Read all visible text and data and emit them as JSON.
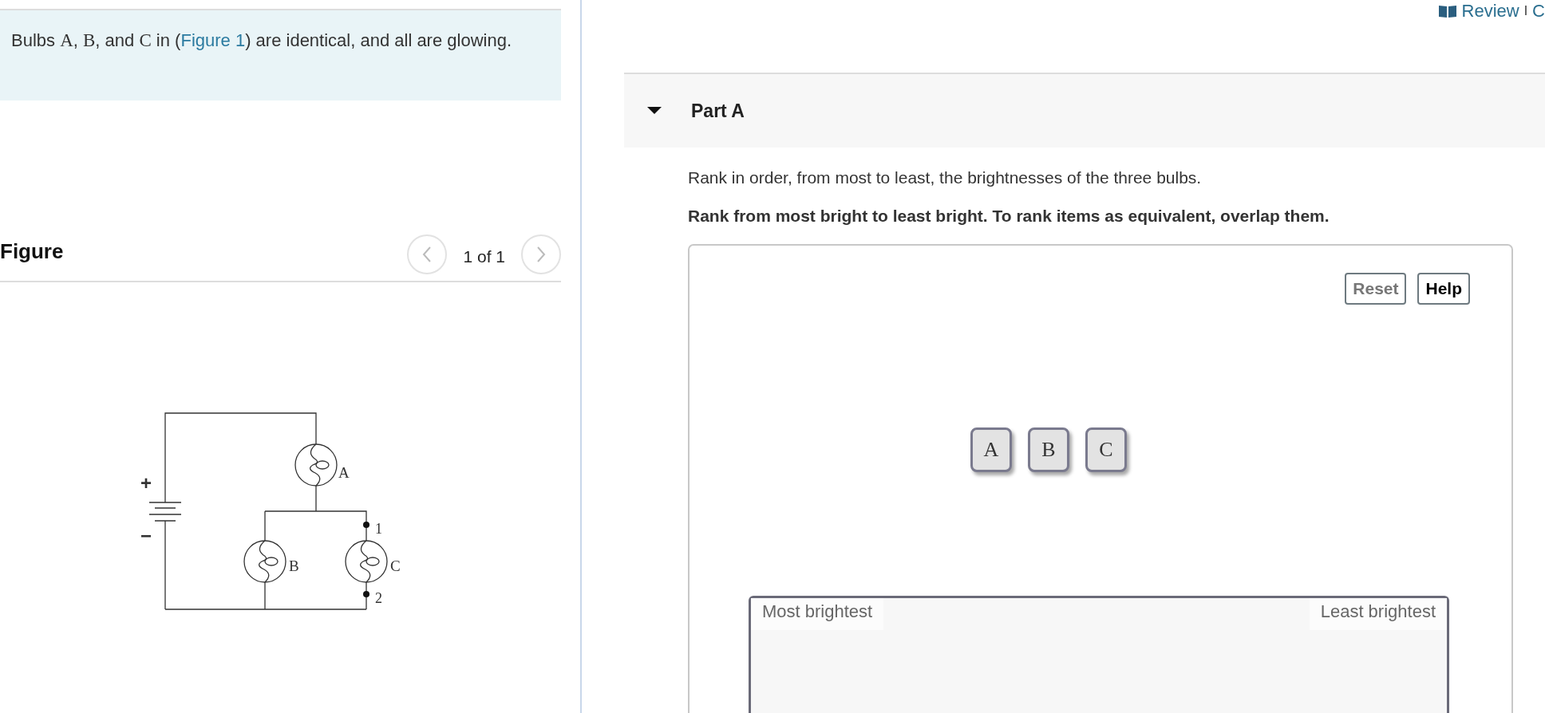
{
  "problem": {
    "parts": [
      {
        "kind": "text",
        "text": "Bulbs "
      },
      {
        "kind": "math",
        "text": "A"
      },
      {
        "kind": "text",
        "text": ", "
      },
      {
        "kind": "math",
        "text": "B"
      },
      {
        "kind": "text",
        "text": ", and "
      },
      {
        "kind": "math",
        "text": "C"
      },
      {
        "kind": "text",
        "text": " in ("
      },
      {
        "kind": "link",
        "text": "Figure 1"
      },
      {
        "kind": "text",
        "text": ") are identical, and all are glowing."
      }
    ]
  },
  "figure": {
    "heading": "Figure",
    "pager": "1 of 1",
    "circuit": {
      "bulbs": [
        {
          "label": "A"
        },
        {
          "label": "B"
        },
        {
          "label": "C"
        }
      ],
      "terminals": [
        "1",
        "2"
      ],
      "battery_signs": [
        "+",
        "−"
      ]
    }
  },
  "header": {
    "review_link": "Review",
    "separator": "I",
    "cut_link": "C"
  },
  "part": {
    "title": "Part A",
    "expanded": true,
    "prompt": "Rank in order, from most to least, the brightnesses of the three bulbs.",
    "instruction": "Rank from most bright to least bright. To rank items as equivalent, overlap them.",
    "buttons": [
      {
        "label": "Reset",
        "disabled": true
      },
      {
        "label": "Help",
        "disabled": false
      }
    ],
    "tiles": [
      "A",
      "B",
      "C"
    ],
    "drop_zone": {
      "left_label": "Most brightest",
      "right_label": "Least brightest"
    }
  }
}
